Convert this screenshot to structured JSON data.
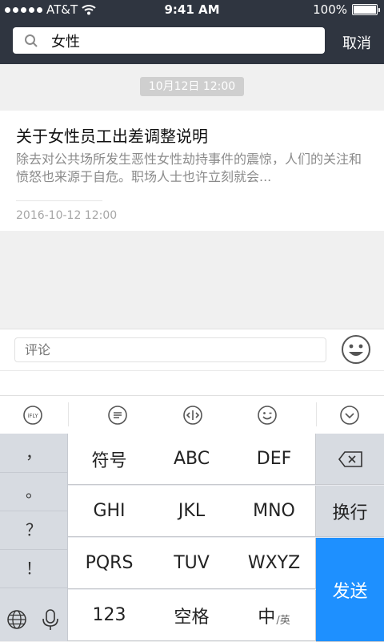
{
  "status": {
    "carrier": "AT&T",
    "time": "9:41 AM",
    "battery": "100%"
  },
  "search": {
    "value": "女性",
    "cancel_label": "取消"
  },
  "feed": {
    "date_chip": "10月12日  12:00",
    "item": {
      "title": "关于女性员工出差调整说明",
      "summary": "除去对公共场所发生恶性女性劫持事件的震惊，人们的关注和愤怒也来源于自危。职场人士也许立刻就会...",
      "time": "2016-10-12  12:00"
    }
  },
  "comment": {
    "placeholder": "评论"
  },
  "keyboard": {
    "toolbar_icons": [
      "ifly-icon",
      "chat-bubble-icon",
      "cursor-move-icon",
      "emoji-icon",
      "collapse-keyboard-icon"
    ],
    "ifly_text": "iFLY",
    "punctuation": [
      "，",
      "。",
      "？",
      "！"
    ],
    "rows": [
      [
        "符号",
        "ABC",
        "DEF"
      ],
      [
        "GHI",
        "JKL",
        "MNO"
      ],
      [
        "PQRS",
        "TUV",
        "WXYZ"
      ],
      [
        "123",
        "空格",
        "中"
      ]
    ],
    "lang_sub": "/英",
    "backspace_icon": "backspace-icon",
    "newline_label": "换行",
    "send_label": "发送",
    "globe_icon": "globe-icon",
    "mic_icon": "microphone-icon"
  },
  "colors": {
    "header_bg": "#2f3540",
    "send_bg": "#1e90ff"
  }
}
